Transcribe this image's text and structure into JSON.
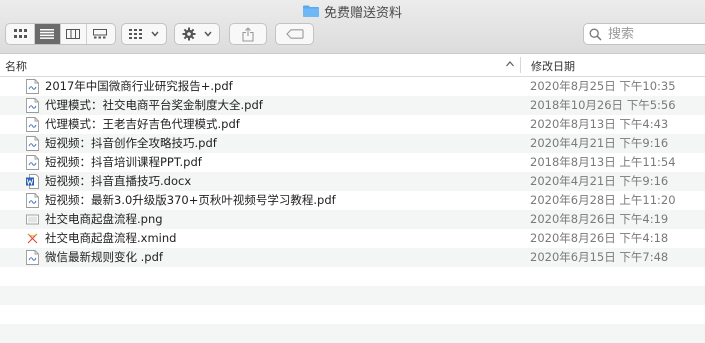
{
  "window": {
    "title": "免费赠送资料"
  },
  "toolbar": {
    "view_modes": [
      "icon-view",
      "list-view",
      "column-view",
      "gallery-view"
    ],
    "active_view": "list-view",
    "group_button": "grid-icon",
    "action_button": "gear-icon",
    "share_button": "share-icon",
    "tag_button": "tag-icon"
  },
  "search": {
    "placeholder": "搜索"
  },
  "columns": {
    "name": "名称",
    "date_modified": "修改日期"
  },
  "files": [
    {
      "name": "2017年中国微商行业研究报告+.pdf",
      "date": "2020年8月25日 下午10:35",
      "type": "pdf"
    },
    {
      "name": "代理模式：社交电商平台奖金制度大全.pdf",
      "date": "2018年10月26日 下午5:56",
      "type": "pdf"
    },
    {
      "name": "代理模式：王老吉好吉色代理模式.pdf",
      "date": "2020年8月13日 下午4:43",
      "type": "pdf"
    },
    {
      "name": "短视频：抖音创作全攻略技巧.pdf",
      "date": "2020年4月21日 下午9:16",
      "type": "pdf"
    },
    {
      "name": "短视频：抖音培训课程PPT.pdf",
      "date": "2018年8月13日 上午11:54",
      "type": "pdf"
    },
    {
      "name": "短视频：抖音直播技巧.docx",
      "date": "2020年4月21日 下午9:16",
      "type": "docx"
    },
    {
      "name": "短视频：最新3.0升级版370+页秋叶视频号学习教程.pdf",
      "date": "2020年6月28日 上午11:20",
      "type": "pdf"
    },
    {
      "name": "社交电商起盘流程.png",
      "date": "2020年8月26日 下午4:19",
      "type": "png"
    },
    {
      "name": "社交电商起盘流程.xmind",
      "date": "2020年8月26日 下午4:18",
      "type": "xmind"
    },
    {
      "name": "微信最新规则变化 .pdf",
      "date": "2020年6月15日 下午7:48",
      "type": "pdf"
    }
  ]
}
